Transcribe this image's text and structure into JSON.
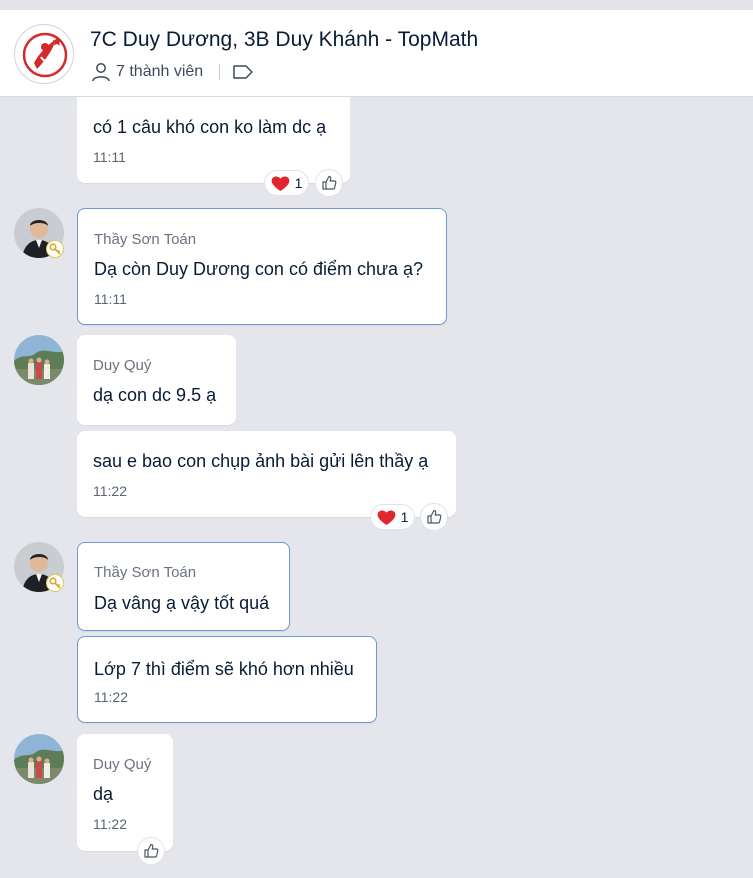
{
  "header": {
    "title": "7C Duy Dương, 3B Duy Khánh - TopMath",
    "members": "7 thành viên",
    "icons": [
      "group-logo-icon",
      "person-icon",
      "tag-icon"
    ]
  },
  "messages": [
    {
      "text": "có 1 câu khó con ko làm dc ạ",
      "time": "11:11",
      "reaction_count": "1"
    },
    {
      "sender": "Thầy Sơn Toán",
      "text": "Dạ còn Duy Dương con có điểm chưa ạ?",
      "time": "11:11"
    },
    {
      "sender": "Duy Quý",
      "text": "dạ con dc 9.5 ạ"
    },
    {
      "text": "sau e bao con chụp ảnh bài gửi lên thầy ạ",
      "time": "11:22",
      "reaction_count": "1"
    },
    {
      "sender": "Thầy Sơn Toán",
      "text": "Dạ vâng ạ vậy tốt quá"
    },
    {
      "text": "Lớp 7 thì điểm sẽ khó hơn nhiều",
      "time": "11:22"
    },
    {
      "sender": "Duy Quý",
      "text": "dạ",
      "time": "11:22"
    }
  ],
  "colors": {
    "accent_border": "#6c99d8",
    "background": "#e4e6ec",
    "heart": "#e0262e"
  }
}
